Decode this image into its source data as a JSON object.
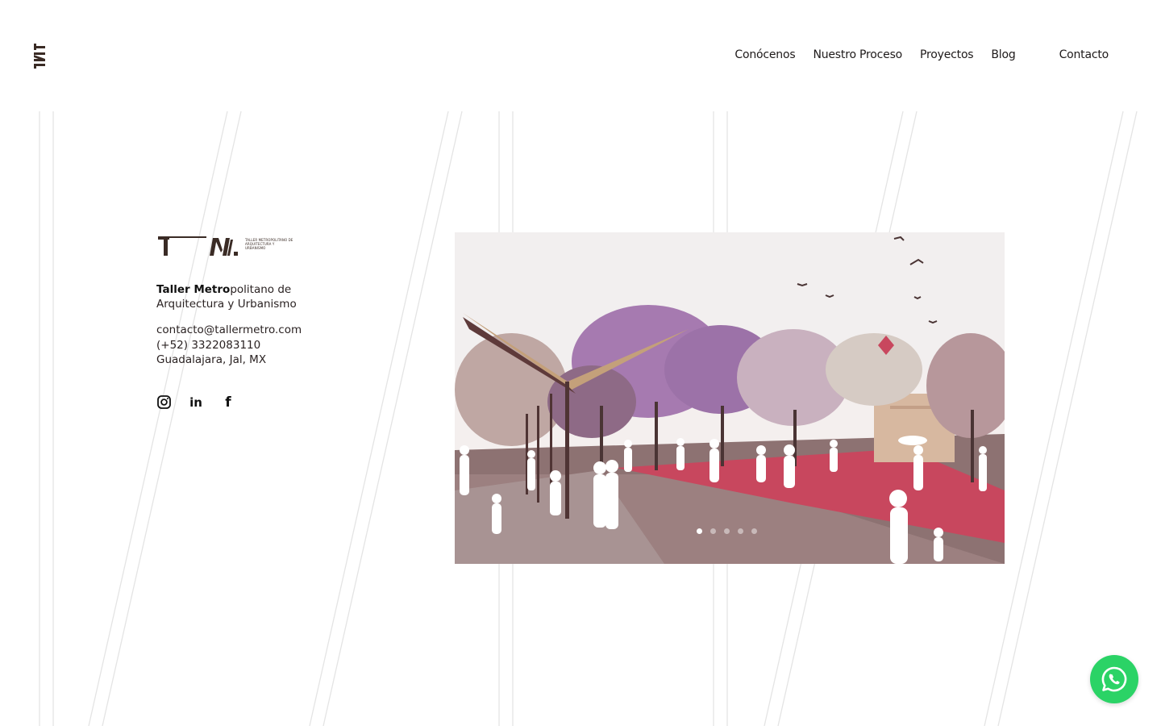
{
  "nav": {
    "items": [
      {
        "label": "Conócenos"
      },
      {
        "label": "Nuestro Proceso"
      },
      {
        "label": "Proyectos"
      },
      {
        "label": "Blog"
      }
    ],
    "contact_label": "Contacto"
  },
  "brand": {
    "logo_mark": "T—M.",
    "logo_small_text": "TALLER METROPOLITANO DE ARQUITECTURA Y URBANISMO",
    "name_bold": "Taller Metro",
    "name_rest": "politano de Arquitectura y Urbanismo",
    "email": "contacto@tallermetro.com",
    "phone": "(+52) 3322083110",
    "location": "Guadalajara, Jal, MX"
  },
  "social": [
    {
      "icon": "instagram-icon"
    },
    {
      "icon": "linkedin-icon",
      "glyph": "in"
    },
    {
      "icon": "facebook-icon",
      "glyph": "f"
    }
  ],
  "hero": {
    "slide_count": 5,
    "active_slide": 1,
    "description": "architectural rendering of a linear park with pergola, purple jacaranda trees, red running track and people silhouettes"
  },
  "colors": {
    "brand_dark": "#3a2b25",
    "track_red": "#c8475e",
    "whatsapp_green": "#2bd366",
    "line_gray": "#e6e6e6"
  },
  "whatsapp": {
    "icon": "whatsapp-icon"
  }
}
